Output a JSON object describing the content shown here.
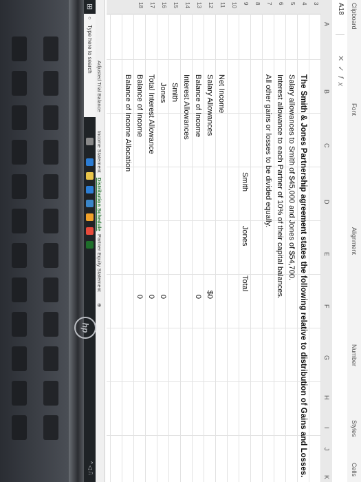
{
  "ribbon": {
    "groups": [
      "Clipboard",
      "Font",
      "Alignment",
      "Number",
      "Styles",
      "Cells"
    ]
  },
  "formula_bar": {
    "name_box": "A18",
    "icons": [
      "cancel-icon",
      "enter-icon",
      "function-icon"
    ],
    "fx": "fx"
  },
  "columns": [
    "A",
    "B",
    "C",
    "D",
    "E",
    "F",
    "G",
    "H",
    "I",
    "J",
    "K"
  ],
  "rows": [
    "3",
    "4",
    "5",
    "6",
    "7",
    "8",
    "9",
    "10",
    "11",
    "12",
    "13",
    "14",
    "15",
    "16",
    "17",
    "18"
  ],
  "sheet": {
    "title": "The Smith & Jones Partnership agreement states the following relative to distribution of Gains and Losses.",
    "line1": "Salary allowances to Smith of $45,000 and Jones of $54,700.",
    "line2": "Interest allowance to each Partner of 10% of their capital balances.",
    "line3": "All other gains or losses to be divided equally.",
    "hdr_smith": "Smith",
    "hdr_jones": "Jones",
    "hdr_total": "Total",
    "net_income": "Net Income",
    "salary_allowances": "Salary Allowances",
    "balance_of_income": "Balance of Income",
    "interest_allowances": "Interest Allowances",
    "smith": "Smith",
    "jones": "Jones",
    "total_interest": "Total Interest Allowance",
    "balance_of_income2": "Balance of Income",
    "balance_allocation": "Balance of Income Allocation",
    "v_salary": "$0",
    "v_balance": "0",
    "v_jones": "0",
    "v_total_interest": "0",
    "v_balance2": "0"
  },
  "tabs": {
    "items": [
      "Adjusted Trial Balance",
      "Income Statement",
      "Distribution Schedule",
      "Partner Equity Statement"
    ],
    "active": "Distribution Schedule"
  },
  "taskbar": {
    "search_placeholder": "Type here to search"
  },
  "logo": "hp",
  "colors": {
    "excel_green": "#1e6e2a",
    "taskbar": "#1f2326"
  }
}
